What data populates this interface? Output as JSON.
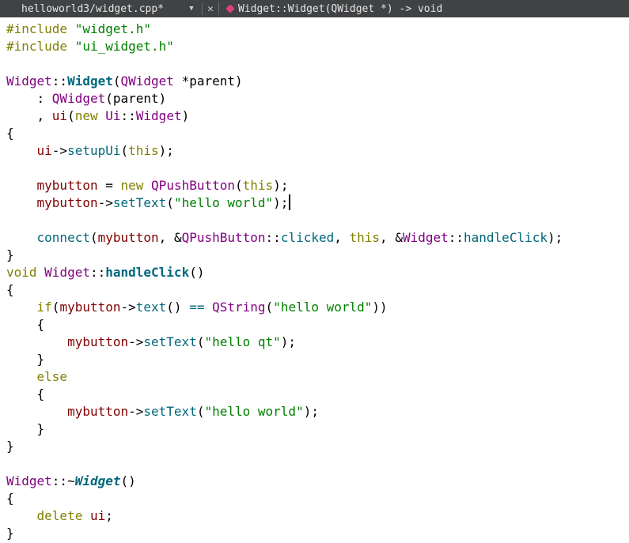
{
  "toolbar": {
    "file_tab": "helloworld3/widget.cpp*",
    "dropdown_glyph": "▼",
    "close_glyph": "✕",
    "symbol_label": "Widget::Widget(QWidget *) -> void",
    "symbol_icon": "function-symbol-icon",
    "symbol_icon_color": "#e0407a",
    "background": "#404244"
  },
  "colors": {
    "keyword": "#808000",
    "type": "#800080",
    "function": "#00677c",
    "string": "#008000",
    "member": "#800000"
  },
  "lines": [
    [
      {
        "t": "#include ",
        "c": "kw"
      },
      {
        "t": "\"widget.h\"",
        "c": "str"
      }
    ],
    [
      {
        "t": "#include ",
        "c": "kw"
      },
      {
        "t": "\"ui_widget.h\"",
        "c": "str"
      }
    ],
    [],
    [
      {
        "t": "Widget",
        "c": "typ"
      },
      {
        "t": "::"
      },
      {
        "t": "Widget",
        "c": "fnb"
      },
      {
        "t": "("
      },
      {
        "t": "QWidget",
        "c": "typ"
      },
      {
        "t": " *"
      },
      {
        "t": "parent"
      },
      {
        "t": ")"
      }
    ],
    [
      {
        "t": "    : "
      },
      {
        "t": "QWidget",
        "c": "typ"
      },
      {
        "t": "(parent)"
      }
    ],
    [
      {
        "t": "    , "
      },
      {
        "t": "ui",
        "c": "mem"
      },
      {
        "t": "("
      },
      {
        "t": "new",
        "c": "kw"
      },
      {
        "t": " "
      },
      {
        "t": "Ui",
        "c": "typ"
      },
      {
        "t": "::"
      },
      {
        "t": "Widget",
        "c": "typ"
      },
      {
        "t": ")"
      }
    ],
    [
      {
        "t": "{"
      }
    ],
    [
      {
        "t": "    "
      },
      {
        "t": "ui",
        "c": "mem"
      },
      {
        "t": "->"
      },
      {
        "t": "setupUi",
        "c": "fn"
      },
      {
        "t": "("
      },
      {
        "t": "this",
        "c": "kw"
      },
      {
        "t": ");"
      }
    ],
    [],
    [
      {
        "t": "    "
      },
      {
        "t": "mybutton",
        "c": "mem"
      },
      {
        "t": " = "
      },
      {
        "t": "new",
        "c": "kw"
      },
      {
        "t": " "
      },
      {
        "t": "QPushButton",
        "c": "typ"
      },
      {
        "t": "("
      },
      {
        "t": "this",
        "c": "kw"
      },
      {
        "t": ");"
      }
    ],
    [
      {
        "t": "    "
      },
      {
        "t": "mybutton",
        "c": "mem"
      },
      {
        "t": "->"
      },
      {
        "t": "setText",
        "c": "fn"
      },
      {
        "t": "("
      },
      {
        "t": "\"hello world\"",
        "c": "str"
      },
      {
        "t": ");"
      },
      {
        "cursor": true
      }
    ],
    [],
    [
      {
        "t": "    "
      },
      {
        "t": "connect",
        "c": "fn"
      },
      {
        "t": "("
      },
      {
        "t": "mybutton",
        "c": "mem"
      },
      {
        "t": ", &"
      },
      {
        "t": "QPushButton",
        "c": "typ"
      },
      {
        "t": "::"
      },
      {
        "t": "clicked",
        "c": "fn"
      },
      {
        "t": ", "
      },
      {
        "t": "this",
        "c": "kw"
      },
      {
        "t": ", &"
      },
      {
        "t": "Widget",
        "c": "typ"
      },
      {
        "t": "::"
      },
      {
        "t": "handleClick",
        "c": "fn"
      },
      {
        "t": ");"
      }
    ],
    [
      {
        "t": "}"
      }
    ],
    [
      {
        "t": "void",
        "c": "kw"
      },
      {
        "t": " "
      },
      {
        "t": "Widget",
        "c": "typ"
      },
      {
        "t": "::"
      },
      {
        "t": "handleClick",
        "c": "fnb"
      },
      {
        "t": "()"
      }
    ],
    [
      {
        "t": "{"
      }
    ],
    [
      {
        "t": "    "
      },
      {
        "t": "if",
        "c": "kw"
      },
      {
        "t": "("
      },
      {
        "t": "mybutton",
        "c": "mem"
      },
      {
        "t": "->"
      },
      {
        "t": "text",
        "c": "fn"
      },
      {
        "t": "() "
      },
      {
        "t": "==",
        "c": "fn"
      },
      {
        "t": " "
      },
      {
        "t": "QString",
        "c": "typ"
      },
      {
        "t": "("
      },
      {
        "t": "\"hello world\"",
        "c": "str"
      },
      {
        "t": "))"
      }
    ],
    [
      {
        "t": "    {"
      }
    ],
    [
      {
        "t": "        "
      },
      {
        "t": "mybutton",
        "c": "mem"
      },
      {
        "t": "->"
      },
      {
        "t": "setText",
        "c": "fn"
      },
      {
        "t": "("
      },
      {
        "t": "\"hello qt\"",
        "c": "str"
      },
      {
        "t": ");"
      }
    ],
    [
      {
        "t": "    }"
      }
    ],
    [
      {
        "t": "    "
      },
      {
        "t": "else",
        "c": "kw"
      }
    ],
    [
      {
        "t": "    {"
      }
    ],
    [
      {
        "t": "        "
      },
      {
        "t": "mybutton",
        "c": "mem"
      },
      {
        "t": "->"
      },
      {
        "t": "setText",
        "c": "fn"
      },
      {
        "t": "("
      },
      {
        "t": "\"hello world\"",
        "c": "str"
      },
      {
        "t": ");"
      }
    ],
    [
      {
        "t": "    }"
      }
    ],
    [
      {
        "t": "}"
      }
    ],
    [],
    [
      {
        "t": "Widget",
        "c": "typ"
      },
      {
        "t": "::~"
      },
      {
        "t": "Widget",
        "c": "fni"
      },
      {
        "t": "()"
      }
    ],
    [
      {
        "t": "{"
      }
    ],
    [
      {
        "t": "    "
      },
      {
        "t": "delete",
        "c": "kw"
      },
      {
        "t": " "
      },
      {
        "t": "ui",
        "c": "mem"
      },
      {
        "t": ";"
      }
    ],
    [
      {
        "t": "}"
      }
    ]
  ]
}
